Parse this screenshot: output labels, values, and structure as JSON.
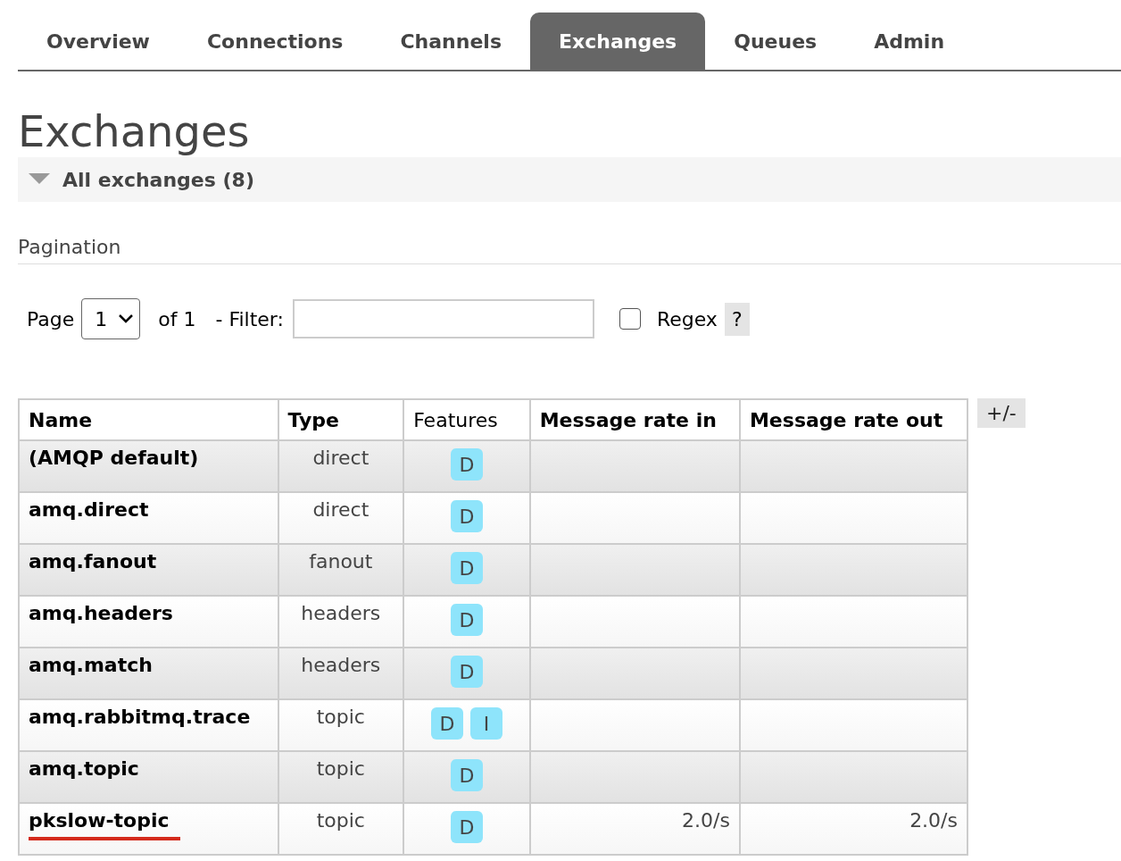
{
  "tabs": [
    {
      "label": "Overview",
      "selected": false
    },
    {
      "label": "Connections",
      "selected": false
    },
    {
      "label": "Channels",
      "selected": false
    },
    {
      "label": "Exchanges",
      "selected": true
    },
    {
      "label": "Queues",
      "selected": false
    },
    {
      "label": "Admin",
      "selected": false
    }
  ],
  "title": "Exchanges",
  "section": {
    "label": "All exchanges (8)",
    "expanded": true
  },
  "pagination": {
    "heading": "Pagination",
    "page_label": "Page",
    "page_value": "1",
    "of_label": "of 1",
    "filter_label": "- Filter:",
    "regex_checked": false,
    "regex_label": "Regex",
    "help": "?"
  },
  "table": {
    "columns": [
      "Name",
      "Type",
      "Features",
      "Message rate in",
      "Message rate out"
    ],
    "toggle": "+/-",
    "rows": [
      {
        "name": "(AMQP default)",
        "type": "direct",
        "features": [
          "D"
        ],
        "rate_in": "",
        "rate_out": "",
        "underlined": false
      },
      {
        "name": "amq.direct",
        "type": "direct",
        "features": [
          "D"
        ],
        "underlined": false
      },
      {
        "name": "amq.fanout",
        "type": "fanout",
        "features": [
          "D"
        ],
        "underlined": false
      },
      {
        "name": "amq.headers",
        "type": "headers",
        "features": [
          "D"
        ],
        "underlined": false
      },
      {
        "name": "amq.match",
        "type": "headers",
        "features": [
          "D"
        ],
        "underlined": false
      },
      {
        "name": "amq.rabbitmq.trace",
        "type": "topic",
        "features": [
          "D",
          "I"
        ],
        "underlined": false
      },
      {
        "name": "amq.topic",
        "type": "topic",
        "features": [
          "D"
        ],
        "underlined": false
      },
      {
        "name": "pkslow-topic",
        "type": "topic",
        "features": [
          "D"
        ],
        "rate_in": "2.0/s",
        "rate_out": "2.0/s",
        "underlined": true
      }
    ]
  }
}
